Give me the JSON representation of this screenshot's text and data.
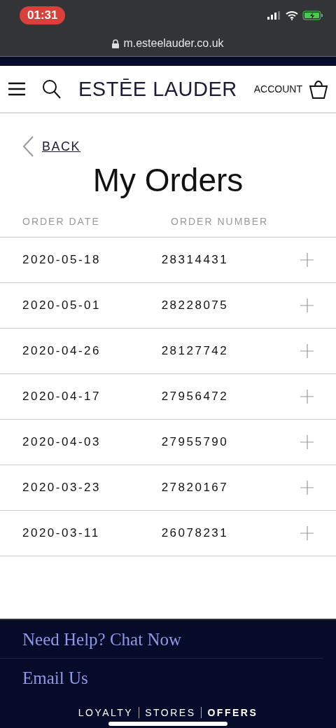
{
  "status_bar": {
    "time": "01:31"
  },
  "browser": {
    "url": "m.esteelauder.co.uk"
  },
  "header": {
    "logo": "ESTĒE LAUDER",
    "account": "ACCOUNT"
  },
  "back_link": "BACK",
  "title": "My Orders",
  "table": {
    "columns": [
      "ORDER DATE",
      "ORDER NUMBER"
    ],
    "rows": [
      {
        "date": "2020-05-18",
        "number": "28314431",
        "expanded": false
      },
      {
        "date": "2020-05-01",
        "number": "28228075",
        "expanded": false
      },
      {
        "date": "2020-04-26",
        "number": "28127742",
        "expanded": false
      },
      {
        "date": "2020-04-17",
        "number": "27956472",
        "expanded": false
      },
      {
        "date": "2020-04-03",
        "number": "27955790",
        "expanded": false
      },
      {
        "date": "2020-03-23",
        "number": "27820167",
        "expanded": false
      },
      {
        "date": "2020-03-11",
        "number": "26078231",
        "expanded": false
      }
    ]
  },
  "footer": {
    "links": [
      "Need Help? Chat Now",
      "Email Us"
    ],
    "tabs": [
      {
        "label": "LOYALTY",
        "selected": false
      },
      {
        "label": "STORES",
        "selected": false
      },
      {
        "label": "OFFERS",
        "selected": true
      }
    ]
  }
}
